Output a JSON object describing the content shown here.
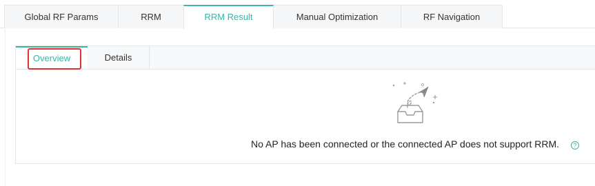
{
  "top_tabs": [
    {
      "label": "Global RF Params",
      "active": false
    },
    {
      "label": "RRM",
      "active": false
    },
    {
      "label": "RRM Result",
      "active": true
    },
    {
      "label": "Manual Optimization",
      "active": false
    },
    {
      "label": "RF Navigation",
      "active": false
    }
  ],
  "sub_tabs": [
    {
      "label": "Overview",
      "active": true
    },
    {
      "label": "Details",
      "active": false
    }
  ],
  "empty_state": {
    "message": "No AP has been connected or the connected AP does not support RRM.",
    "icon": "empty-inbox-paper-plane-icon",
    "help_icon": "question-circle-icon"
  },
  "colors": {
    "accent": "#3cb3a4",
    "highlight": "#e03131",
    "tab_background": "#f5f7f9",
    "border": "#e4e7ea"
  }
}
